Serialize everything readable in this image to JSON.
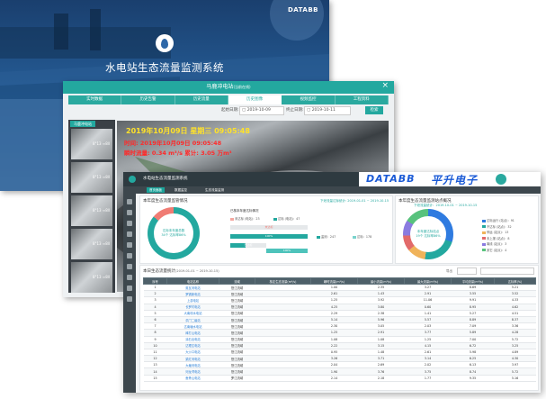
{
  "window1": {
    "title": "水电站生态流量监测系统",
    "brand": "DATABB"
  },
  "window2": {
    "header_title": "马鹿冲电站",
    "header_sub": "(当前在线)",
    "close": "×",
    "tabs": [
      {
        "label": "实时数据",
        "active": false
      },
      {
        "label": "历史告警",
        "active": false
      },
      {
        "label": "历史流量",
        "active": false
      },
      {
        "label": "历史图像",
        "active": true
      },
      {
        "label": "视频监控",
        "active": false
      },
      {
        "label": "工程资料",
        "active": false
      }
    ],
    "start_label": "起始日期:",
    "start_value": "2019-10-09",
    "end_label": "终止日期:",
    "end_value": "2019-10-11",
    "query_label": "检索",
    "side_header": "马鹿冲电站",
    "thumbs": [
      {
        "label": "8°13 ≈8ll"
      },
      {
        "label": "8°13 ≈8ll"
      },
      {
        "label": "8°13 ≈8ll"
      },
      {
        "label": "8°13 ≈8ll"
      },
      {
        "label": "8°13 ≈8ll"
      }
    ],
    "overlay": {
      "date": "2019年10月09日  星期三  09:05:48",
      "line1": "时间: 2019年10月09日 09:05:48",
      "line2": "瞬时流量: 0.34 m³/s  累计: 3.05 万m³"
    }
  },
  "window3": {
    "app_title": "水电站生态流量监测系统",
    "brand_left": "DATABB",
    "brand_right": "平升电子",
    "nav_tabs": [
      {
        "label": "首页面板",
        "active": true
      },
      {
        "label": "数据监控",
        "active": false
      },
      {
        "label": "生态流量监测",
        "active": false
      }
    ],
    "panel1_title": "本年度生态流量监管情况",
    "panel1_note": "下泄流量达标统计: 2019-01-01 ~ 2019-10-15",
    "donut1_text1": "达标本年度总数",
    "donut1_text2": "34个  达标率86%",
    "bar_head": "已核本年度达标情况",
    "bar_legend": [
      {
        "label": "未达标 (电站)：23",
        "color": "#f4a7a0"
      },
      {
        "label": "达标 (电站)：47",
        "color": "#23a89f"
      }
    ],
    "bars": [
      {
        "label": "未达标",
        "fraction": 0.0,
        "color": "#f07c74"
      },
      {
        "label": "100%",
        "fraction": 1.0,
        "color": "#23a89f"
      },
      {
        "label": "已达标",
        "fraction": 0.42,
        "color": "#23a89f"
      },
      {
        "label": "100%",
        "fraction": 1.0,
        "color": "#4ec3bb"
      }
    ],
    "bar_stats": [
      {
        "label": "监测：247",
        "color": "#23a89f"
      },
      {
        "label": "达标：178",
        "color": "#7ad3cd"
      }
    ],
    "panel2_title": "本年度生态流量监测站点概况",
    "panel2_note": "下泄流量统计：2019-10-01 ~ 2019-10-15",
    "donut2_text1": "本年度达标站点",
    "donut2_text2": "19个  达标率86%",
    "legend2": [
      {
        "label": "达标运行 (站点)：91",
        "color": "#2f7be0"
      },
      {
        "label": "不达标 (站点)：32",
        "color": "#23a89f"
      },
      {
        "label": "停运 (站点)：13",
        "color": "#f0b35a"
      },
      {
        "label": "未上报 (站点)：8",
        "color": "#e26a6a"
      },
      {
        "label": "离线 (站点)：3",
        "color": "#8a7be0"
      },
      {
        "label": "其它 (站点)：4",
        "color": "#58c27d"
      }
    ],
    "table_title": "本日生态流量统计",
    "table_range": "(2019-01-01 ~ 2019-10-15)",
    "export_label": "导出",
    "columns": [
      "序号",
      "电站名称",
      "流域",
      "核定生态流量(m³/s)",
      "瞬时流量(m³/s)",
      "最小流量(m³/s)",
      "最大流量(m³/s)",
      "平均流量(m³/s)",
      "达标率(%)"
    ],
    "rows": [
      [
        "1",
        "奥瓦河电站",
        "怒江流域",
        "1.00",
        "2.35",
        "3.27",
        "8.69",
        "5.21"
      ],
      [
        "2",
        "罗锅新电站",
        "怒江流域",
        "2.61",
        "1.43",
        "2.91",
        "3.55",
        "3.52"
      ],
      [
        "3",
        "上游电站",
        "怒江流域",
        "1.25",
        "3.92",
        "11.06",
        "9.91",
        "4.33"
      ],
      [
        "4",
        "长罗村电站",
        "怒江流域",
        "4.25",
        "3.80",
        "0.60",
        "8.95",
        "4.62"
      ],
      [
        "5",
        "大南坝水电站",
        "怒江流域",
        "2.29",
        "2.38",
        "1.41",
        "5.27",
        "4.51"
      ],
      [
        "6",
        "洪门二级站",
        "怒江流域",
        "5.14",
        "5.96",
        "5.57",
        "8.89",
        "8.37"
      ],
      [
        "7",
        "达南塘水电站",
        "怒江流域",
        "2.30",
        "3.05",
        "2.03",
        "7.09",
        "3.36"
      ],
      [
        "8",
        "棒打山电站",
        "怒江流域",
        "1.25",
        "2.91",
        "3.77",
        "5.89",
        "4.28"
      ],
      [
        "9",
        "涂石出电站",
        "怒江流域",
        "1.08",
        "1.08",
        "1.25",
        "7.00",
        "5.72"
      ],
      [
        "10",
        "达理达电站",
        "怒江流域",
        "2.22",
        "3.15",
        "4.15",
        "6.72",
        "3.25"
      ],
      [
        "11",
        "大沙口电站",
        "怒江流域",
        "0.95",
        "1.48",
        "2.61",
        "5.98",
        "4.89"
      ],
      [
        "12",
        "梁红河电站",
        "怒江流域",
        "3.26",
        "3.71",
        "3.14",
        "6.25",
        "4.30"
      ],
      [
        "13",
        "大塘河电站",
        "怒江流域",
        "2.04",
        "2.69",
        "2.02",
        "6.13",
        "3.97"
      ],
      [
        "14",
        "河龙湾电站",
        "怒江流域",
        "1.90",
        "3.76",
        "3.75",
        "8.74",
        "5.72"
      ],
      [
        "15",
        "鱼骨山电站",
        "罗江流域",
        "2.14",
        "2.18",
        "1.77",
        "9.35",
        "5.16"
      ]
    ]
  }
}
